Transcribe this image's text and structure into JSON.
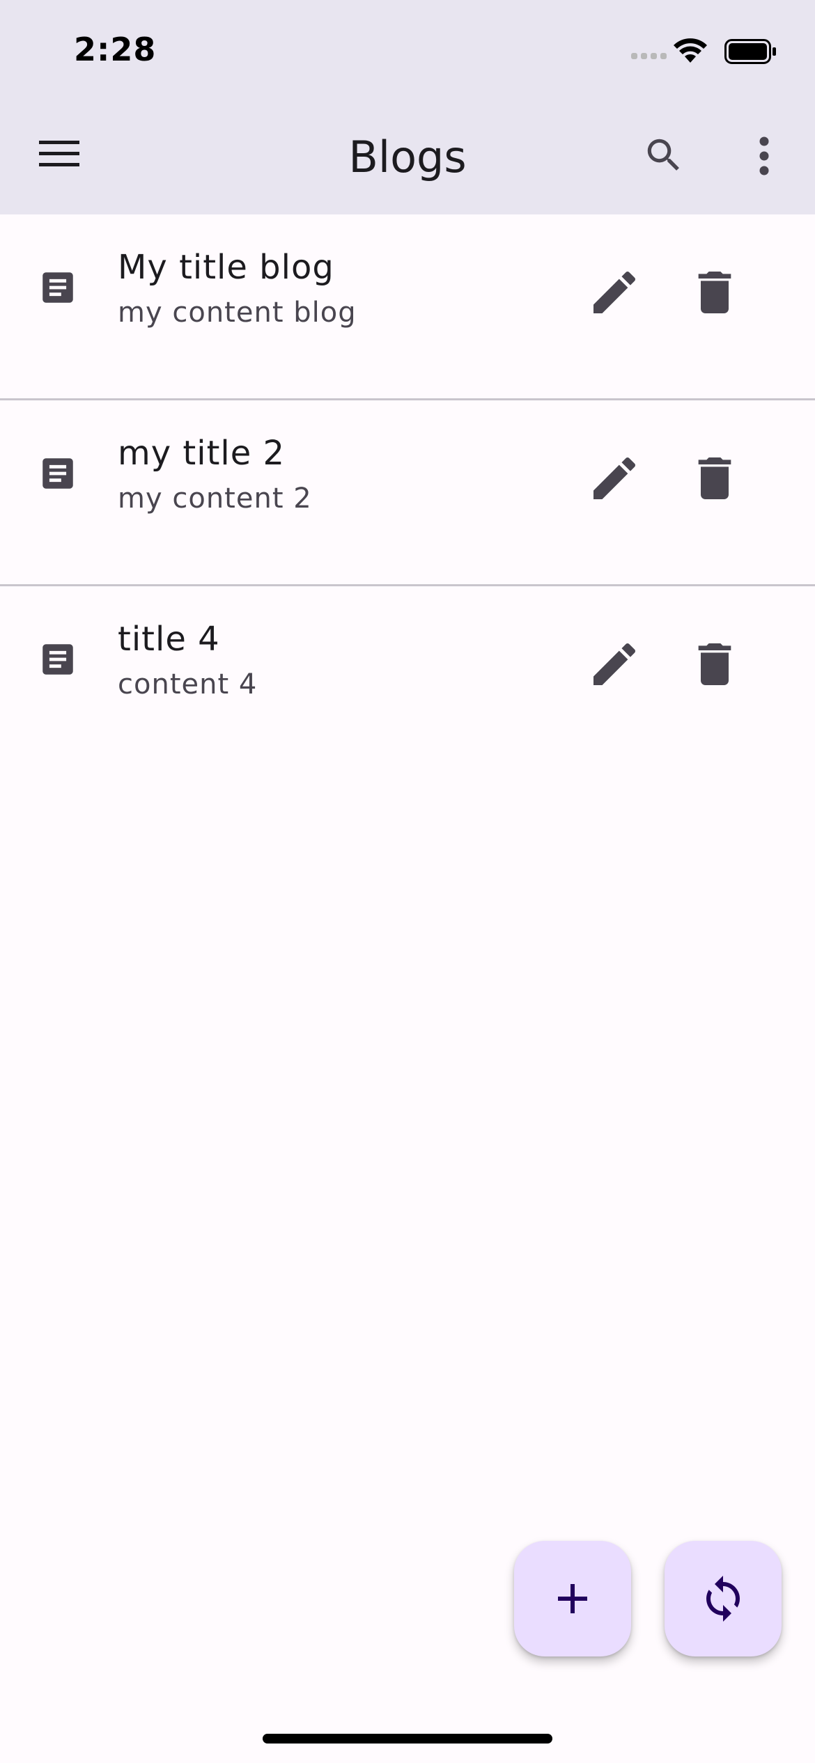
{
  "status_bar": {
    "time": "2:28"
  },
  "app_bar": {
    "title": "Blogs",
    "icons": [
      "menu-icon",
      "search-icon",
      "more-vert-icon"
    ]
  },
  "blogs": [
    {
      "title": "My title blog",
      "content": "my content blog"
    },
    {
      "title": "my title 2",
      "content": "my content 2"
    },
    {
      "title": "title 4",
      "content": "content 4"
    }
  ],
  "item_icons": [
    "article-icon",
    "edit-icon",
    "delete-icon"
  ],
  "fabs": [
    {
      "icon": "add-icon"
    },
    {
      "icon": "sync-icon"
    }
  ],
  "colors": {
    "app_bar_bg": "#e8e5f0",
    "background": "#fffbfe",
    "fab_bg": "#eaddff",
    "fab_icon": "#21005d",
    "icon": "#49454f",
    "divider": "#c9c5cc"
  }
}
